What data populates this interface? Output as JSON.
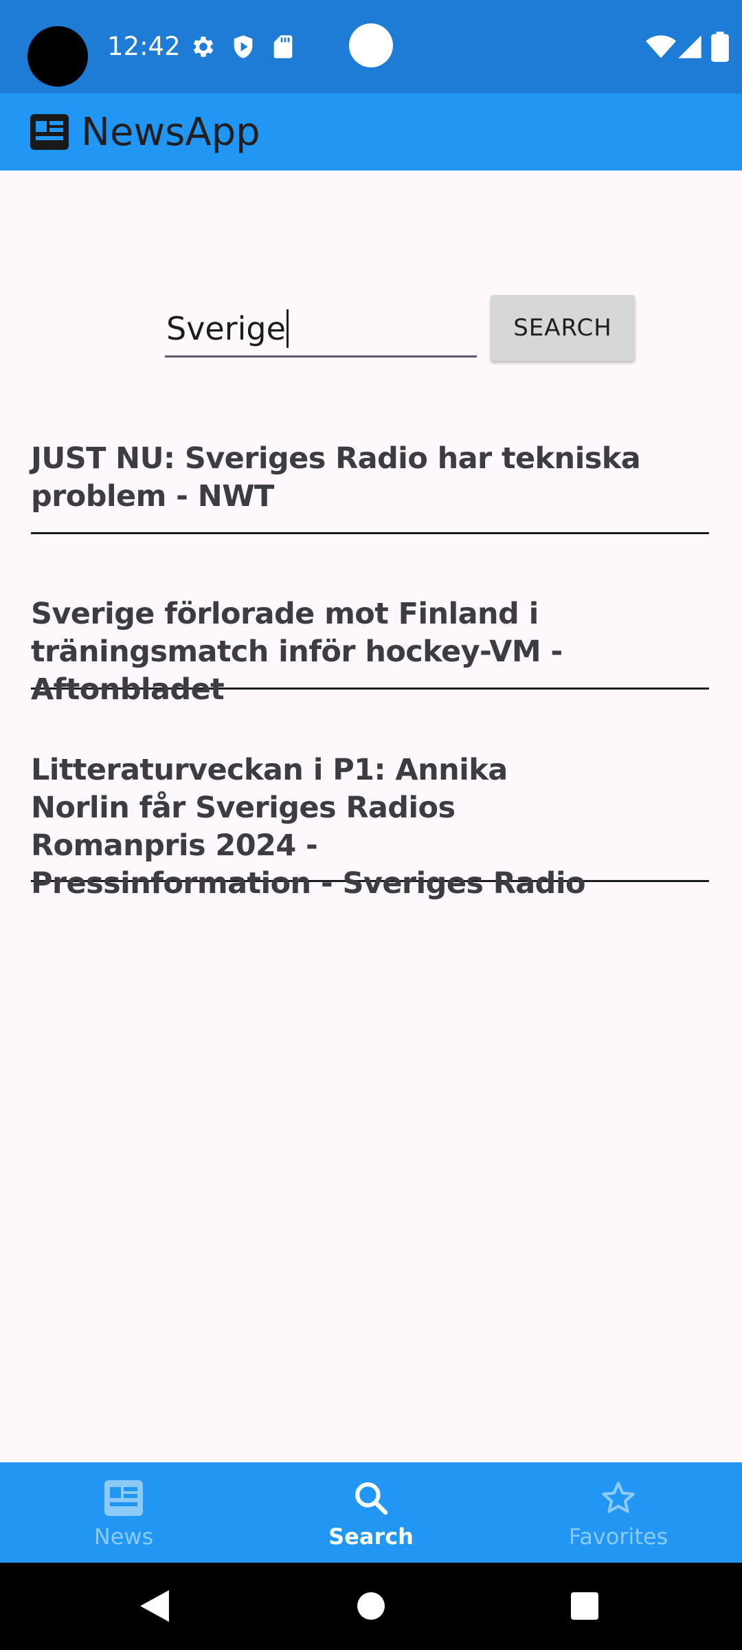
{
  "status_bar": {
    "time": "12:42",
    "icons": [
      "gear-icon",
      "shield-play-icon",
      "sd-card-icon",
      "wifi-icon",
      "signal-icon",
      "battery-icon"
    ]
  },
  "app_bar": {
    "title": "NewsApp",
    "logo_icon": "newspaper-icon"
  },
  "search": {
    "value": "Sverige",
    "button_label": "SEARCH"
  },
  "results": [
    {
      "title": "JUST NU: Sveriges Radio har tekniska problem - NWT"
    },
    {
      "title": "Sverige förlorade mot Finland i träningsmatch inför hockey-VM - Aftonbladet"
    },
    {
      "title": "Litteraturveckan i P1: Annika Norlin får Sveriges Radios Romanpris 2024 - Pressinformation - Sveriges Radio"
    }
  ],
  "bottom_nav": {
    "items": [
      {
        "label": "News",
        "icon": "newspaper-icon",
        "active": false
      },
      {
        "label": "Search",
        "icon": "search-icon",
        "active": true
      },
      {
        "label": "Favorites",
        "icon": "star-icon",
        "active": false
      }
    ]
  },
  "colors": {
    "status_bar": "#1e7bd6",
    "app_bar": "#2196f3",
    "background": "#fdf8fc",
    "nav_active": "#ffffff",
    "nav_inactive": "#8ccbf7"
  }
}
